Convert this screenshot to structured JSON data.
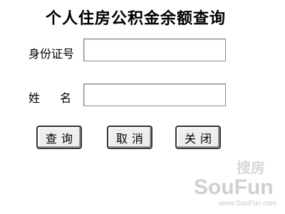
{
  "form": {
    "title": "个人住房公积金余额查询",
    "id_label": "身份证号",
    "id_value": "",
    "name_label": "姓名",
    "name_value": ""
  },
  "buttons": {
    "query": "查询",
    "cancel": "取消",
    "close": "关闭"
  },
  "watermark": {
    "brand_cn": "搜房",
    "brand_en": "SouFun",
    "url": "www.SouFun.com",
    "color": "#cfcfcf"
  }
}
